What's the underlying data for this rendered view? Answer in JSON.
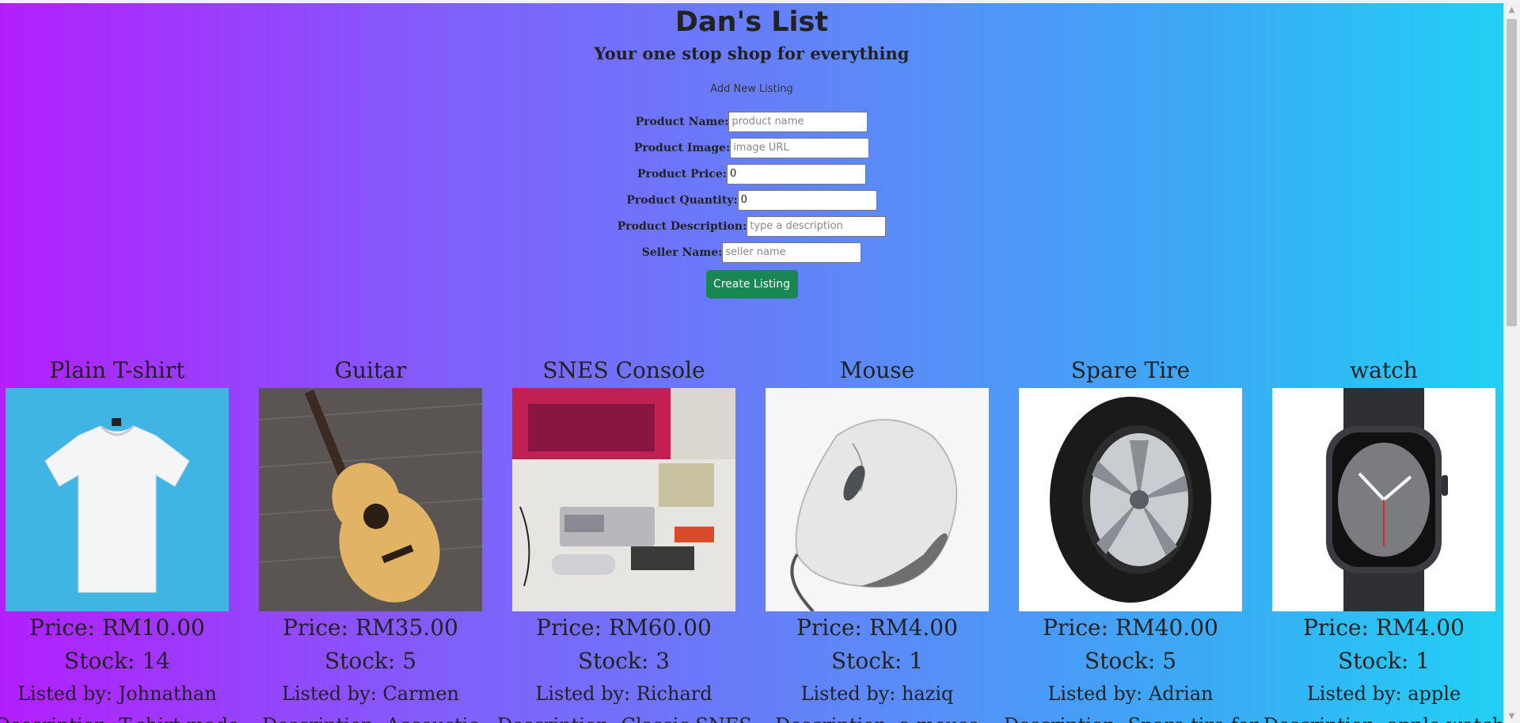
{
  "header": {
    "title": "Dan's List",
    "tagline": "Your one stop shop for everything"
  },
  "form": {
    "title": "Add New Listing",
    "fields": [
      {
        "label": "Product Name:",
        "placeholder": "product name",
        "value": ""
      },
      {
        "label": "Product Image:",
        "placeholder": "image URL",
        "value": ""
      },
      {
        "label": "Product Price:",
        "placeholder": "",
        "value": "0"
      },
      {
        "label": "Product Quantity:",
        "placeholder": "",
        "value": "0"
      },
      {
        "label": "Product Description:",
        "placeholder": "type a description",
        "value": ""
      },
      {
        "label": "Seller Name:",
        "placeholder": "seller name",
        "value": ""
      }
    ],
    "submit_label": "Create Listing",
    "submit_color": "#198754"
  },
  "products": [
    {
      "name": "Plain T-shirt",
      "image_icon": "tshirt-image",
      "price": "Price: RM10.00",
      "stock": "Stock: 14",
      "seller": "Listed by: Johnathan",
      "description": "Description: T-shirt made"
    },
    {
      "name": "Guitar",
      "image_icon": "guitar-image",
      "price": "Price: RM35.00",
      "stock": "Stock: 5",
      "seller": "Listed by: Carmen",
      "description": "Description: Accoustic"
    },
    {
      "name": "SNES Console",
      "image_icon": "snes-console-image",
      "price": "Price: RM60.00",
      "stock": "Stock: 3",
      "seller": "Listed by: Richard",
      "description": "Description: Classic SNES"
    },
    {
      "name": "Mouse",
      "image_icon": "mouse-image",
      "price": "Price: RM4.00",
      "stock": "Stock: 1",
      "seller": "Listed by: haziq",
      "description": "Description: a mouse"
    },
    {
      "name": "Spare Tire",
      "image_icon": "tire-image",
      "price": "Price: RM40.00",
      "stock": "Stock: 5",
      "seller": "Listed by: Adrian",
      "description": "Description: Spare tire for"
    },
    {
      "name": "watch",
      "image_icon": "watch-image",
      "price": "Price: RM4.00",
      "stock": "Stock: 1",
      "seller": "Listed by: apple",
      "description": "Description: apple watch"
    }
  ]
}
